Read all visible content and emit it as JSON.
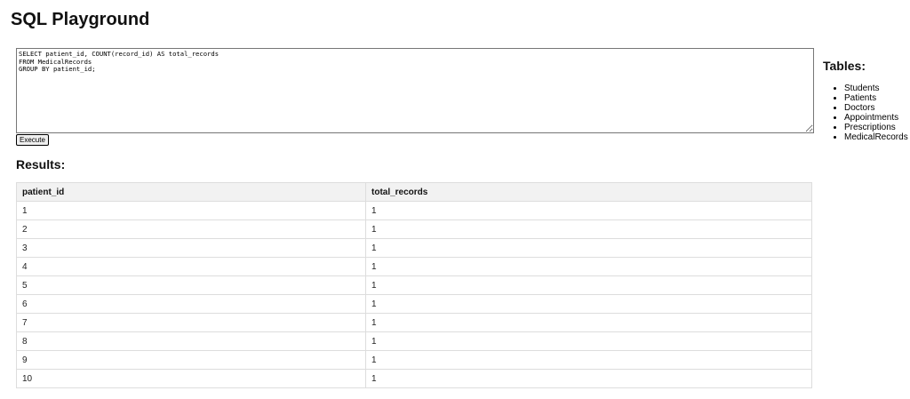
{
  "page": {
    "title": "SQL Playground"
  },
  "editor": {
    "query": "SELECT patient_id, COUNT(record_id) AS total_records\nFROM MedicalRecords\nGROUP BY patient_id;"
  },
  "toolbar": {
    "execute_label": "Execute"
  },
  "results": {
    "heading": "Results:",
    "columns": [
      "patient_id",
      "total_records"
    ],
    "rows": [
      [
        "1",
        "1"
      ],
      [
        "2",
        "1"
      ],
      [
        "3",
        "1"
      ],
      [
        "4",
        "1"
      ],
      [
        "5",
        "1"
      ],
      [
        "6",
        "1"
      ],
      [
        "7",
        "1"
      ],
      [
        "8",
        "1"
      ],
      [
        "9",
        "1"
      ],
      [
        "10",
        "1"
      ]
    ]
  },
  "sidebar": {
    "title": "Tables:",
    "tables": [
      "Students",
      "Patients",
      "Doctors",
      "Appointments",
      "Prescriptions",
      "MedicalRecords"
    ]
  },
  "colors": {
    "header_background": "#f2f2f2",
    "cell_border": "#dddddd",
    "textarea_border": "#767676"
  }
}
